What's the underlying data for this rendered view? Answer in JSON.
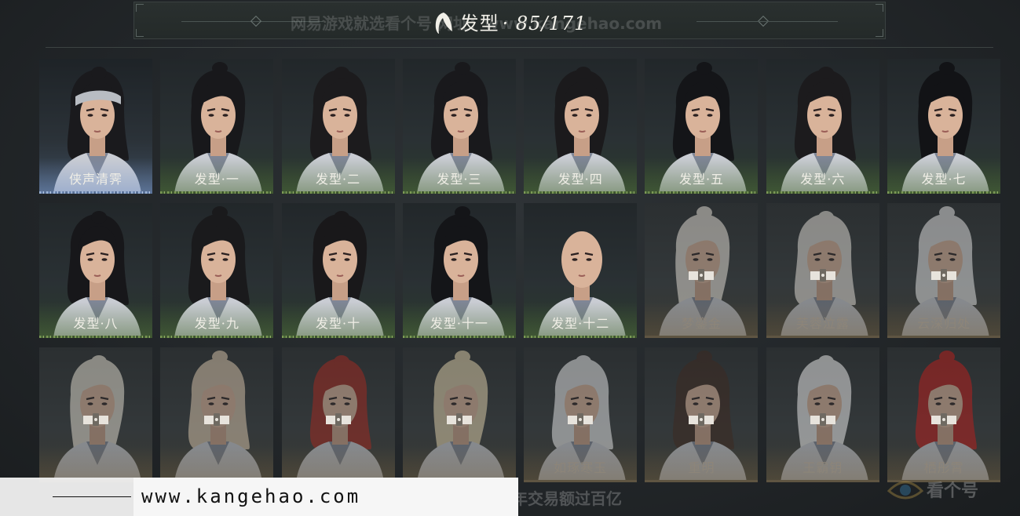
{
  "header": {
    "title": "发型",
    "count": "· 85/171"
  },
  "watermarks": {
    "top": "网易游戏就选看个号  网址：www.kangehao.com",
    "url": "www.kangehao.com",
    "bottom": "看个号专业网易游戏八年   年交易额过百亿",
    "brand": "看个号"
  },
  "hairstyles": [
    {
      "label": "侠声清霁",
      "state": "selected",
      "hair": "#1a1a1d",
      "band": true
    },
    {
      "label": "发型·一",
      "state": "owned",
      "hair": "#18181b"
    },
    {
      "label": "发型·二",
      "state": "owned",
      "hair": "#1c1b1d"
    },
    {
      "label": "发型·三",
      "state": "owned",
      "hair": "#19191c"
    },
    {
      "label": "发型·四",
      "state": "owned",
      "hair": "#1b1a1c"
    },
    {
      "label": "发型·五",
      "state": "owned",
      "hair": "#141518"
    },
    {
      "label": "发型·六",
      "state": "owned",
      "hair": "#1c1b1d"
    },
    {
      "label": "发型·七",
      "state": "owned",
      "hair": "#121316"
    },
    {
      "label": "发型·八",
      "state": "owned",
      "hair": "#17171a"
    },
    {
      "label": "发型·九",
      "state": "owned",
      "hair": "#1a1a1c"
    },
    {
      "label": "发型·十",
      "state": "owned",
      "hair": "#19181a"
    },
    {
      "label": "发型·十一",
      "state": "owned",
      "hair": "#141518"
    },
    {
      "label": "发型·十二",
      "state": "owned",
      "hair": "bald"
    },
    {
      "label": "梦鎏金",
      "state": "locked",
      "hair": "#d9d4cc"
    },
    {
      "label": "芙蓉泣露",
      "state": "locked",
      "hair": "#d6d2cc"
    },
    {
      "label": "云深归处",
      "state": "locked",
      "hair": "#d8d8d8"
    },
    {
      "label": "",
      "state": "locked",
      "hair": "#d7d2c6"
    },
    {
      "label": "",
      "state": "locked",
      "hair": "#cdbba4"
    },
    {
      "label": "",
      "state": "locked",
      "hair": "#9c2a22"
    },
    {
      "label": "",
      "state": "locked",
      "hair": "#d4c6a4"
    },
    {
      "label": "如琢寒玉",
      "state": "locked",
      "hair": "#d9dadb"
    },
    {
      "label": "重明",
      "state": "locked",
      "hair": "#3d2a22"
    },
    {
      "label": "王霸钥",
      "state": "locked",
      "hair": "#e2e2e2"
    },
    {
      "label": "栖彤霄",
      "state": "locked",
      "hair": "#b3201e"
    }
  ],
  "colors": {
    "background": "#23272a",
    "owned_grass": "#7c9a55",
    "selected_grass": "#9fb6d8",
    "locked_label": "#8d8579"
  }
}
